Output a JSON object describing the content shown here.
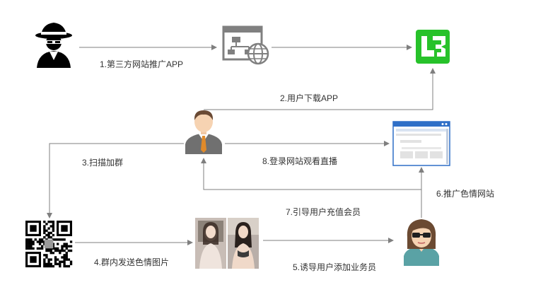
{
  "colors": {
    "arrow": "#7f7f7f",
    "brand_green": "#27c22a",
    "browser_blue": "#2f6fc7",
    "glasses_dark": "#202020",
    "shirt_teal": "#5aa2a5"
  },
  "nodes": [
    {
      "id": "hacker",
      "icon": "hacker-icon"
    },
    {
      "id": "website",
      "icon": "website-sitemap-icon"
    },
    {
      "id": "app",
      "icon": "app-logo-icon"
    },
    {
      "id": "user",
      "icon": "businessman-icon"
    },
    {
      "id": "browser",
      "icon": "browser-window-icon"
    },
    {
      "id": "qrcode",
      "icon": "qr-code-icon"
    },
    {
      "id": "photos",
      "icon": "photo-pair-icon"
    },
    {
      "id": "agent",
      "icon": "sunglasses-woman-icon"
    }
  ],
  "steps": {
    "s1": "1.第三方网站推广APP",
    "s2": "2.用户下载APP",
    "s3": "3.扫描加群",
    "s4": "4.群内发送色情图片",
    "s5": "5.诱导用户添加业务员",
    "s6": "6.推广色情网站",
    "s7": "7.引导用户充值会员",
    "s8": "8.登录网站观看直播"
  }
}
